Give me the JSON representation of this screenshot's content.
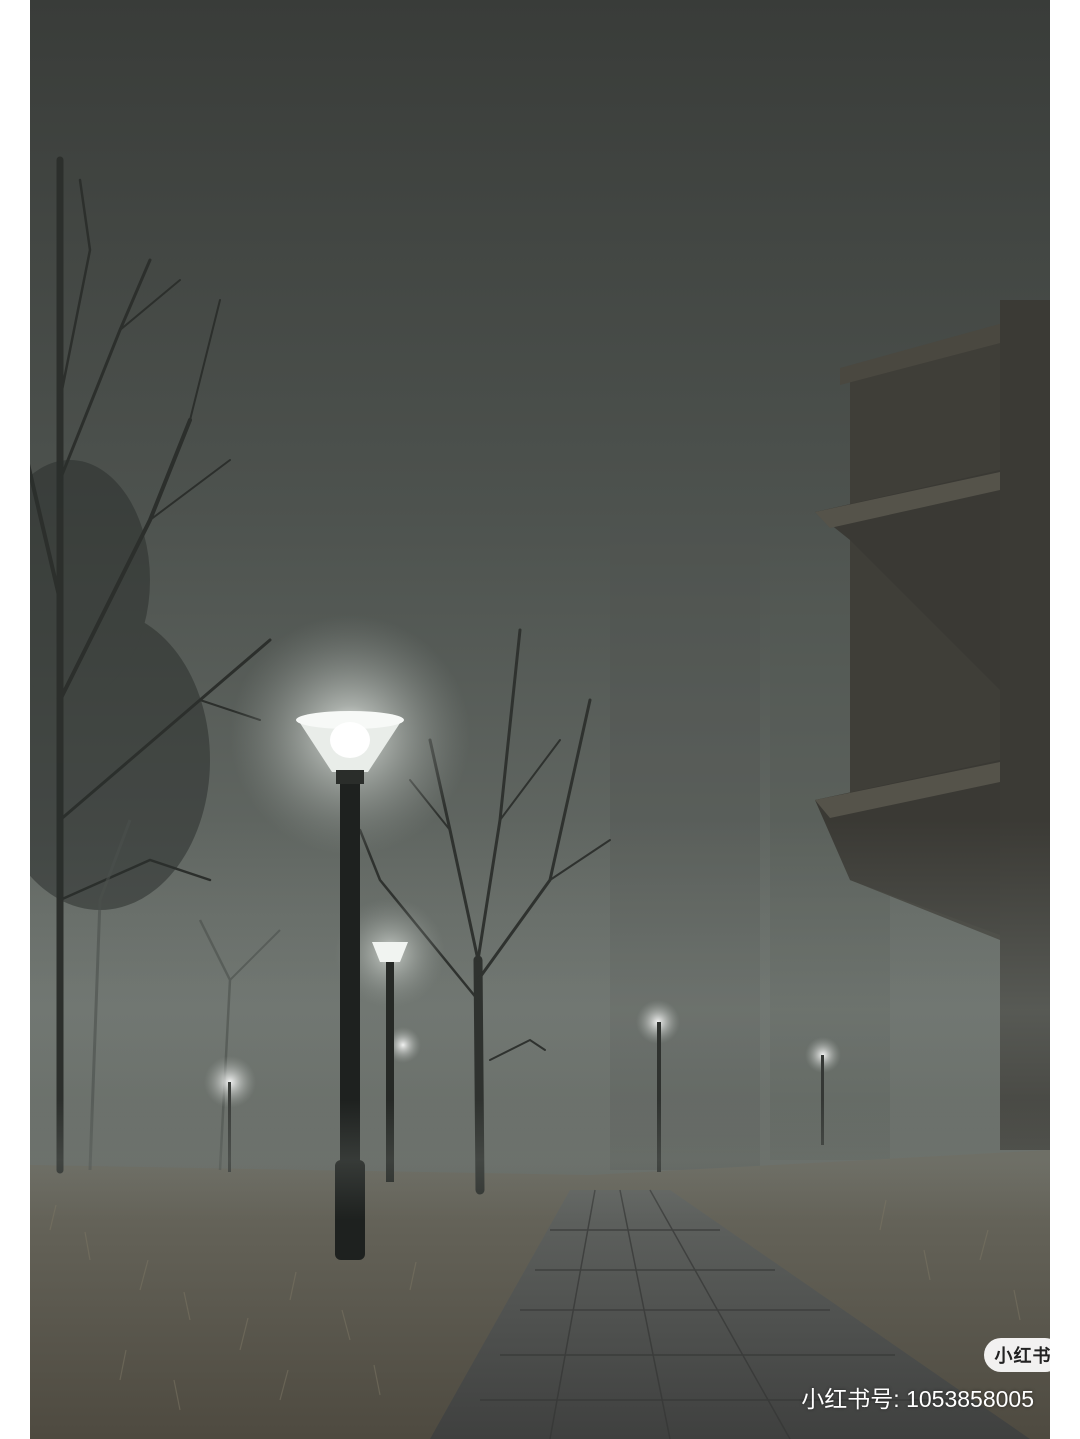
{
  "watermark": {
    "logo_text": "小红书",
    "account_id": "小红书号: 1053858005"
  },
  "colors": {
    "fog_top": "#3c403c",
    "fog_mid": "#6e746f",
    "ground": "#5f5a4e",
    "path": "#4c4d4b",
    "lamp_glow": "#f4f7f4"
  }
}
